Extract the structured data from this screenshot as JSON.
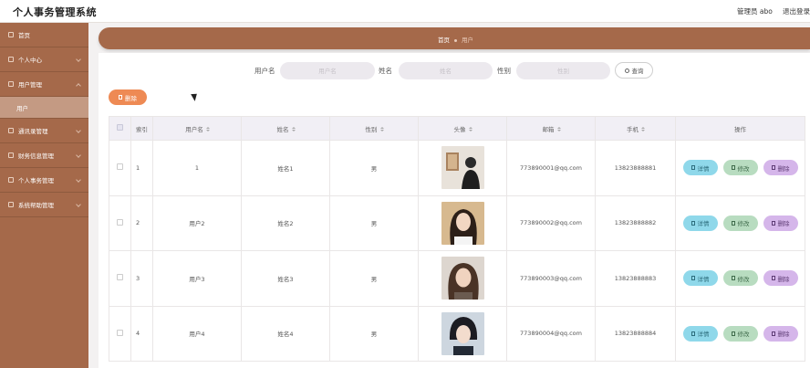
{
  "app": {
    "title": "个人事务管理系统",
    "admin_label": "管理员 abo",
    "logout_label": "退出登录"
  },
  "sidebar": {
    "items": [
      {
        "label": "首页",
        "icon": "home-icon",
        "name": "sidebar-item-home"
      },
      {
        "label": "个人中心",
        "icon": "user-icon",
        "name": "sidebar-item-personal-center"
      },
      {
        "label": "用户管理",
        "icon": "users-icon",
        "name": "sidebar-item-user-management"
      },
      {
        "label": "通讯录管理",
        "icon": "contacts-icon",
        "name": "sidebar-item-contacts"
      },
      {
        "label": "财务信息管理",
        "icon": "finance-icon",
        "name": "sidebar-item-finance"
      },
      {
        "label": "个人事务管理",
        "icon": "tasks-icon",
        "name": "sidebar-item-affairs"
      },
      {
        "label": "系统帮助管理",
        "icon": "help-icon",
        "name": "sidebar-item-help"
      }
    ],
    "active_sub": "用户"
  },
  "breadcrumb": {
    "home": "首页",
    "current": "用户"
  },
  "search": {
    "username_label": "用户名",
    "username_placeholder": "用户名",
    "name_label": "姓名",
    "name_placeholder": "姓名",
    "gender_label": "性别",
    "gender_placeholder": "性别",
    "query_label": "查询"
  },
  "toolbar": {
    "delete_label": "删除"
  },
  "table": {
    "headers": {
      "index": "索引",
      "username": "用户名",
      "name": "姓名",
      "gender": "性别",
      "avatar": "头像",
      "email": "邮箱",
      "phone": "手机",
      "actions": "操作"
    },
    "rows": [
      {
        "index": "1",
        "username": "1",
        "name": "姓名1",
        "gender": "男",
        "email": "773890001@qq.com",
        "phone": "13823888881"
      },
      {
        "index": "2",
        "username": "用户2",
        "name": "姓名2",
        "gender": "男",
        "email": "773890002@qq.com",
        "phone": "13823888882"
      },
      {
        "index": "3",
        "username": "用户3",
        "name": "姓名3",
        "gender": "男",
        "email": "773890003@qq.com",
        "phone": "13823888883"
      },
      {
        "index": "4",
        "username": "用户4",
        "name": "姓名4",
        "gender": "男",
        "email": "773890004@qq.com",
        "phone": "13823888884"
      }
    ],
    "actions": {
      "detail": "详情",
      "edit": "修改",
      "delete": "删除"
    }
  },
  "colors": {
    "brand": "#a5694a",
    "brand_light": "#c49a83",
    "delete_orange": "#ee8a54",
    "detail_blue": "#8fd8ea",
    "edit_green": "#b8dcc0",
    "delete_purple": "#d5b6ea"
  }
}
